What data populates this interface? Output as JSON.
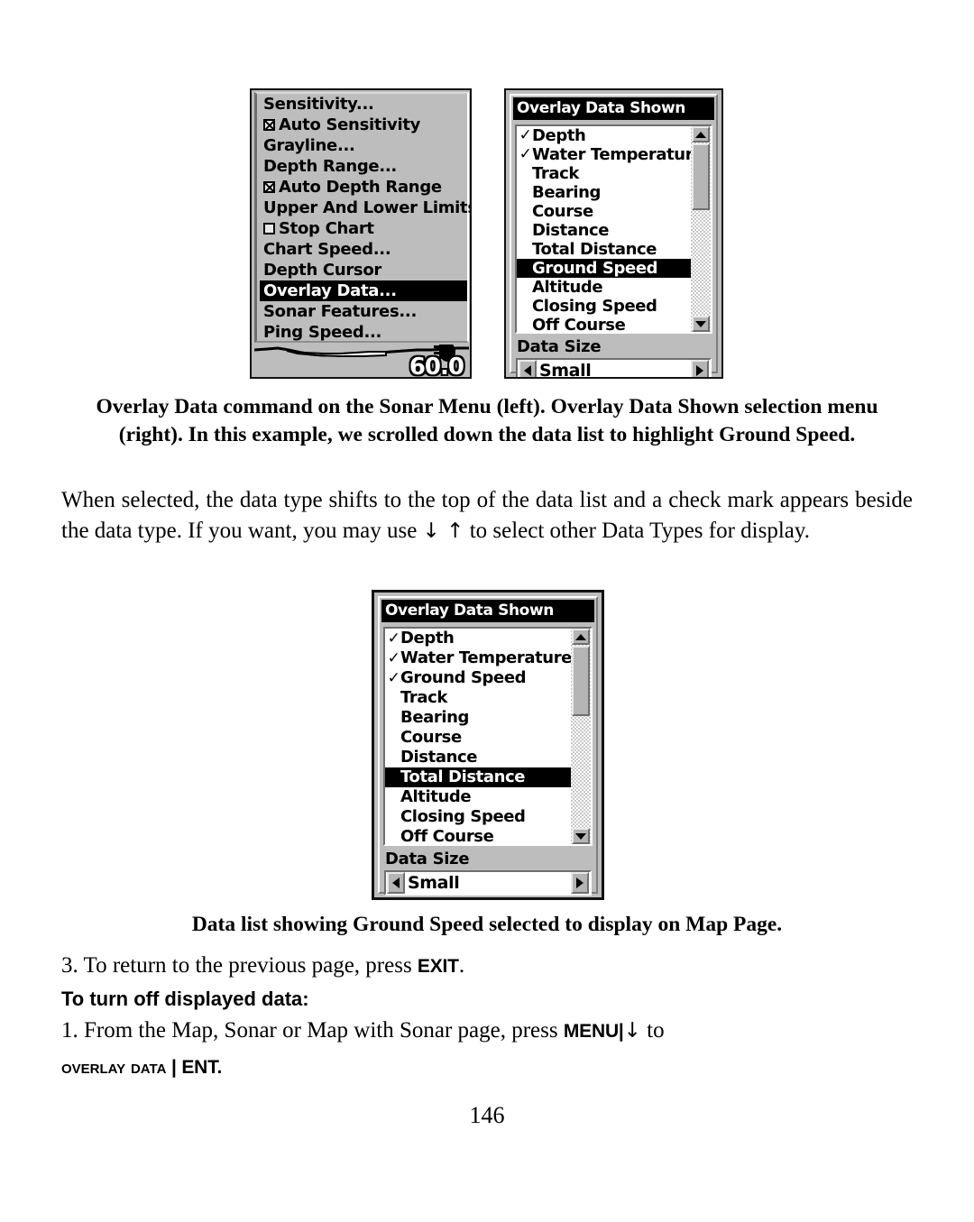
{
  "figure1": {
    "sonar_menu": {
      "items": [
        {
          "label": "Sensitivity...",
          "checkbox": null,
          "selected": false
        },
        {
          "label": "Auto Sensitivity",
          "checkbox": "checked",
          "selected": false
        },
        {
          "label": "Grayline...",
          "checkbox": null,
          "selected": false
        },
        {
          "label": "Depth Range...",
          "checkbox": null,
          "selected": false
        },
        {
          "label": "Auto Depth Range",
          "checkbox": "checked",
          "selected": false
        },
        {
          "label": "Upper And Lower Limits..",
          "checkbox": null,
          "selected": false
        },
        {
          "label": "Stop Chart",
          "checkbox": "unchecked",
          "selected": false
        },
        {
          "label": "Chart Speed...",
          "checkbox": null,
          "selected": false
        },
        {
          "label": "Depth Cursor",
          "checkbox": null,
          "selected": false
        },
        {
          "label": "Overlay Data...",
          "checkbox": null,
          "selected": true
        },
        {
          "label": "Sonar Features...",
          "checkbox": null,
          "selected": false
        },
        {
          "label": "Ping Speed...",
          "checkbox": null,
          "selected": false
        }
      ],
      "depth_readout": "60.0"
    },
    "overlay_dialog": {
      "title": "Overlay Data Shown",
      "items": [
        {
          "label": "Depth",
          "checked": true,
          "highlighted": false
        },
        {
          "label": "Water Temperature",
          "checked": true,
          "highlighted": false
        },
        {
          "label": "Track",
          "checked": false,
          "highlighted": false
        },
        {
          "label": "Bearing",
          "checked": false,
          "highlighted": false
        },
        {
          "label": "Course",
          "checked": false,
          "highlighted": false
        },
        {
          "label": "Distance",
          "checked": false,
          "highlighted": false
        },
        {
          "label": "Total Distance",
          "checked": false,
          "highlighted": false
        },
        {
          "label": "Ground Speed",
          "checked": false,
          "highlighted": true
        },
        {
          "label": "Altitude",
          "checked": false,
          "highlighted": false
        },
        {
          "label": "Closing Speed",
          "checked": false,
          "highlighted": false
        },
        {
          "label": "Off Course",
          "checked": false,
          "highlighted": false
        }
      ],
      "data_size_label": "Data Size",
      "data_size_value": "Small"
    }
  },
  "figure2": {
    "overlay_dialog": {
      "title": "Overlay Data Shown",
      "items": [
        {
          "label": "Depth",
          "checked": true,
          "highlighted": false
        },
        {
          "label": "Water Temperature",
          "checked": true,
          "highlighted": false
        },
        {
          "label": "Ground Speed",
          "checked": true,
          "highlighted": false
        },
        {
          "label": "Track",
          "checked": false,
          "highlighted": false
        },
        {
          "label": "Bearing",
          "checked": false,
          "highlighted": false
        },
        {
          "label": "Course",
          "checked": false,
          "highlighted": false
        },
        {
          "label": "Distance",
          "checked": false,
          "highlighted": false
        },
        {
          "label": "Total Distance",
          "checked": false,
          "highlighted": true
        },
        {
          "label": "Altitude",
          "checked": false,
          "highlighted": false
        },
        {
          "label": "Closing Speed",
          "checked": false,
          "highlighted": false
        },
        {
          "label": "Off Course",
          "checked": false,
          "highlighted": false
        }
      ],
      "data_size_label": "Data Size",
      "data_size_value": "Small"
    }
  },
  "captions": {
    "figure1": "Overlay Data command on the Sonar Menu (left). Overlay Data Shown selection menu (right). In this example, we scrolled down the data list to highlight Ground Speed.",
    "figure2": "Data list showing Ground Speed selected to display on Map Page."
  },
  "body": {
    "paragraph1_part1": "When selected, the data type shifts to the top of the data list and a check mark appears beside the data type. If you want, you may use ",
    "paragraph1_arrows": "↓ ↑",
    "paragraph1_part2": " to select other Data Types for display.",
    "step3_text": "3. To return to the previous page, press ",
    "step3_key": "EXIT",
    "step3_end": ".",
    "subheading": "To turn off displayed data:",
    "step1_text": "1. From the Map, Sonar or Map with Sonar page, press ",
    "step1_key": "MENU",
    "step1_sep": "|",
    "step1_arrow": "↓",
    "step1_end": " to",
    "overlay_line_smallcaps": "Overlay Data",
    "overlay_line_sep": " | ",
    "overlay_line_key": "ENT",
    "overlay_line_end": "."
  },
  "page_number": "146",
  "colors": {
    "lcd_background": "#bdbdbd",
    "lcd_border": "#111111",
    "highlight_background": "#000000",
    "highlight_text": "#ffffff",
    "list_background": "#ffffff",
    "text": "#000000"
  }
}
